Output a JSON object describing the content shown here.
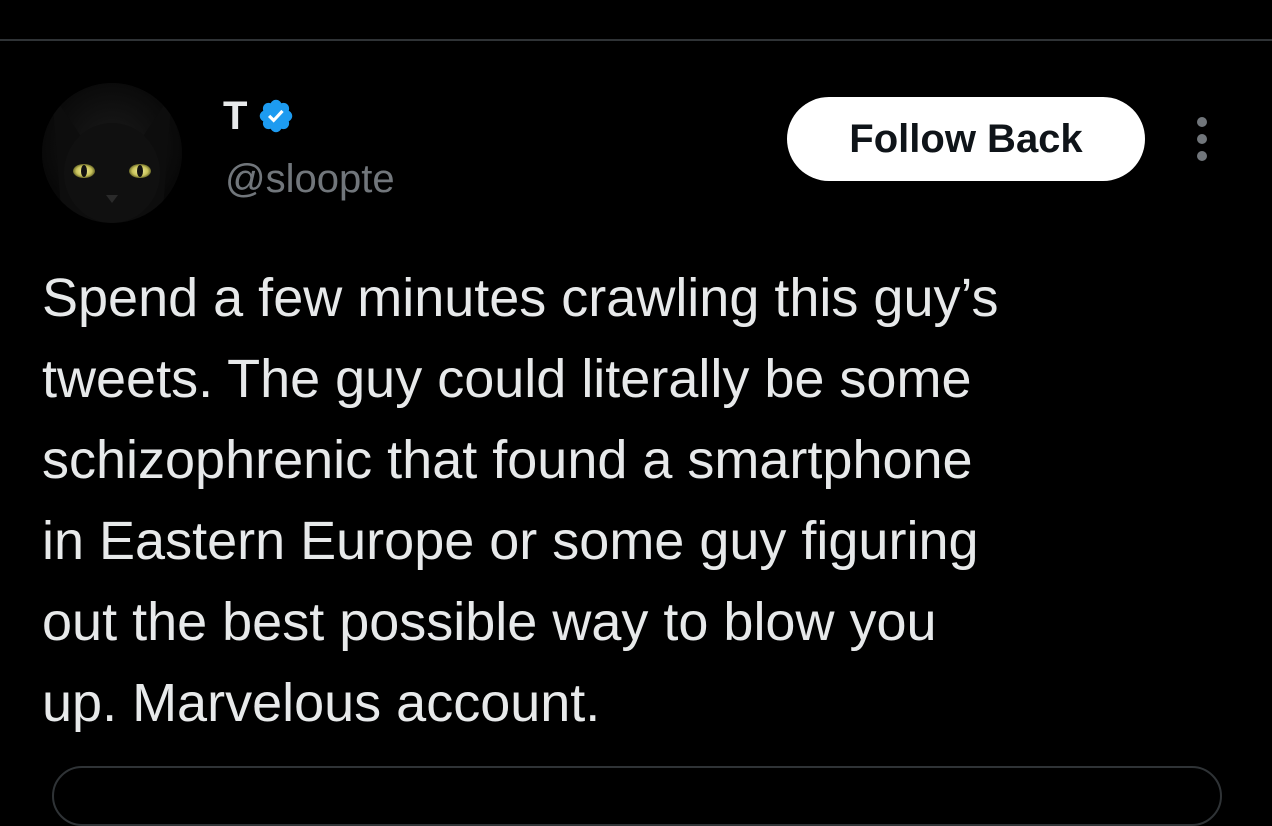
{
  "tweet": {
    "author": {
      "display_name": "T",
      "verified": true,
      "verified_icon": "verified-badge-icon",
      "handle": "@sloopte",
      "avatar": "black-cat-avatar"
    },
    "follow_button_label": "Follow Back",
    "more_icon": "more-options-icon",
    "text": "Spend a few minutes crawling this guy’s\ntweets. The guy could literally be some\nschizophrenic that found a smartphone\nin Eastern Europe or some guy figuring\nout the best possible way to blow you\nup. Marvelous account."
  },
  "colors": {
    "background": "#000000",
    "text_primary": "#e7e9ea",
    "text_secondary": "#71767b",
    "verified_blue": "#1d9bf0",
    "follow_button_bg": "#ffffff",
    "follow_button_text": "#0f1419",
    "divider": "#2f3336"
  }
}
